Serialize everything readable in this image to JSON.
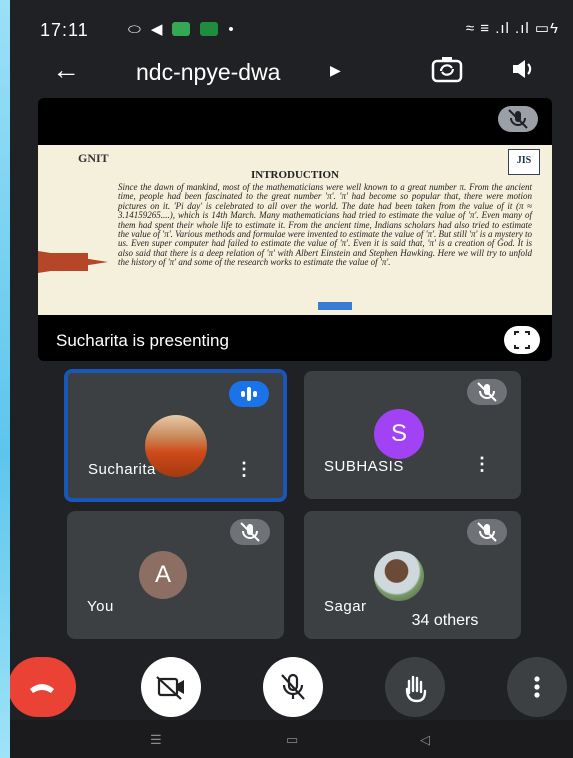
{
  "status": {
    "time": "17:11",
    "right_text": "≈ ≡ .ıl .ıl ▭ϟ",
    "icon_colors": [
      "#5f6368",
      "#4285f4",
      "#34a853",
      "#0f9d58"
    ]
  },
  "header": {
    "meeting_code": "ndc-npye-dwa",
    "back_icon": "arrow-left-icon",
    "caret_icon": "caret-right-icon",
    "camera_flip_icon": "camera-flip-icon",
    "speaker_icon": "speaker-icon"
  },
  "presentation": {
    "presenter_text": "Sucharita is presenting",
    "slide": {
      "logo_left": "GNIT",
      "logo_right": "JIS",
      "title": "INTRODUCTION",
      "body": "Since the dawn of mankind, most of the mathematicians were well known to a great number π. From the ancient time, people had been fascinated to the great number 'π'. 'π' had become so popular that, there were motion pictures on it. 'Pi day' is celebrated to all over the world. The date had been taken from the value of it (π ≈ 3.14159265....), which is 14th March. Many mathematicians had tried to estimate the value of 'π'. Even many of them had spent their whole life to estimate it. From the ancient time, Indians scholars had also tried to estimate the value of 'π'. Various methods and formulae were invented to estimate the value of 'π'. But still 'π' is a mystery to us. Even super computer had failed to estimate the value of 'π'. Even it is said that, 'π' is a creation of God. It is also said that there is a deep relation of 'π' with Albert Einstein and Stephen Hawking. Here we will try to unfold the history of 'π' and some of the research works to estimate the value of 'π'."
    }
  },
  "participants": [
    {
      "name": "Sucharita",
      "avatar_type": "photo",
      "speaking": true
    },
    {
      "name": "SUBHASIS",
      "avatar_type": "initial",
      "initial": "S",
      "color": "#a142f4",
      "muted": true
    },
    {
      "name": "You",
      "avatar_type": "initial",
      "initial": "A",
      "color": "#8d6e63",
      "muted": true
    },
    {
      "name": "Sagar",
      "avatar_type": "photo",
      "muted": true
    }
  ],
  "others_label": "34 others",
  "controls": [
    {
      "name": "end-call-button",
      "icon": "phone-hangup-icon"
    },
    {
      "name": "camera-toggle-button",
      "icon": "camera-off-icon"
    },
    {
      "name": "mic-toggle-button",
      "icon": "mic-off-icon"
    },
    {
      "name": "raise-hand-button",
      "icon": "hand-icon"
    },
    {
      "name": "more-options-button",
      "icon": "more-vert-icon"
    }
  ]
}
